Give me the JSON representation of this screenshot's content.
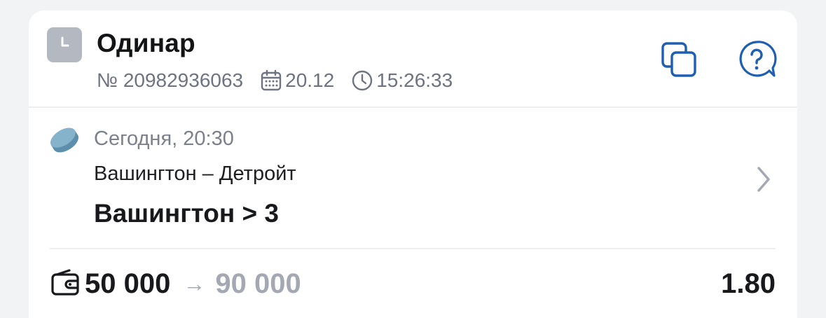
{
  "bet": {
    "type": "Одинар",
    "number": "№ 20982936063",
    "date": "20.12",
    "time": "15:26:33",
    "status_icon": "clock-icon"
  },
  "event": {
    "sport_icon": "hockey-puck-icon",
    "start": "Сегодня, 20:30",
    "teams": "Вашингтон – Детройт",
    "pick": "Вашингтон > 3"
  },
  "footer": {
    "stake": "50 000",
    "arrow": "→",
    "payout": "90 000",
    "odds": "1.80"
  },
  "colors": {
    "accent": "#1e5fb4",
    "badge": "#b3b8c1",
    "puck": "#6e9fbd",
    "muted": "#a3a8b2"
  }
}
